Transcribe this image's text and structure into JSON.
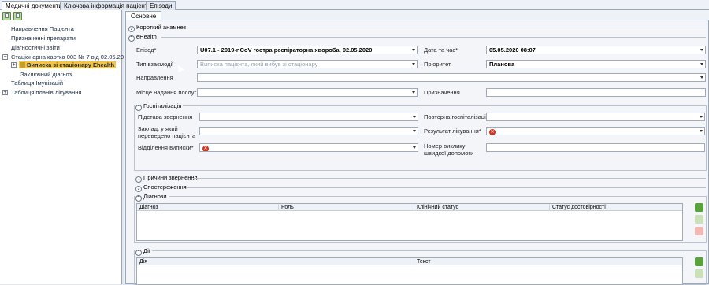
{
  "top_tabs": [
    "Медичні документи",
    "Ключова інформація пацієнта",
    "Епізоди"
  ],
  "tree": {
    "items": [
      "Направлення Пацієнта",
      "Призначенні препарати",
      "Діагностичні звіти",
      "Стаціонарна картка 003 № 7 від 02.05.2020",
      "Виписка зі стаціонару Ehealth",
      "Заключний діагноз",
      "Таблиця Імунізацій",
      "Таблиця планів лікування"
    ]
  },
  "subtab": "Основне",
  "sections": {
    "short_anamnesis": "Короткий анамнез",
    "ehealth": "eHealth",
    "hospitalization": "Госпіталізація",
    "reasons": "Причини звернення",
    "observations": "Спостереження",
    "diagnoses": "Діагнози",
    "actions": "Дії"
  },
  "form": {
    "episode_label": "Епізод*",
    "episode_value": "U07.1 - 2019-nCoV гостра респіраторна хвороба, 02.05.2020",
    "datetime_label": "Дата та час*",
    "datetime_value": "05.05.2020 08:07",
    "interaction_label": "Тип взаємодії",
    "interaction_placeholder": "Виписка пацієнта, який вибув зі стаціонару",
    "priority_label": "Пріоритет",
    "priority_value": "Планова",
    "referral_label": "Направлення",
    "place_label": "Місце надання послуг",
    "assignment_label": "Призначення",
    "reason_label": "Підстава звернення",
    "rehosp_label": "Повторна госпіталізація",
    "transfer_label": "Заклад, у який переведено пацієнта",
    "result_label": "Результат лікування*",
    "dept_label": "Відділення виписки*",
    "ambulance_label": "Номер виклику швидкої допомоги"
  },
  "diag_grid": {
    "columns": [
      "Діагноз",
      "Роль",
      "Клінічний статус",
      "Статус достовірності"
    ]
  },
  "actions_grid": {
    "columns": [
      "Дія",
      "Текст"
    ]
  }
}
